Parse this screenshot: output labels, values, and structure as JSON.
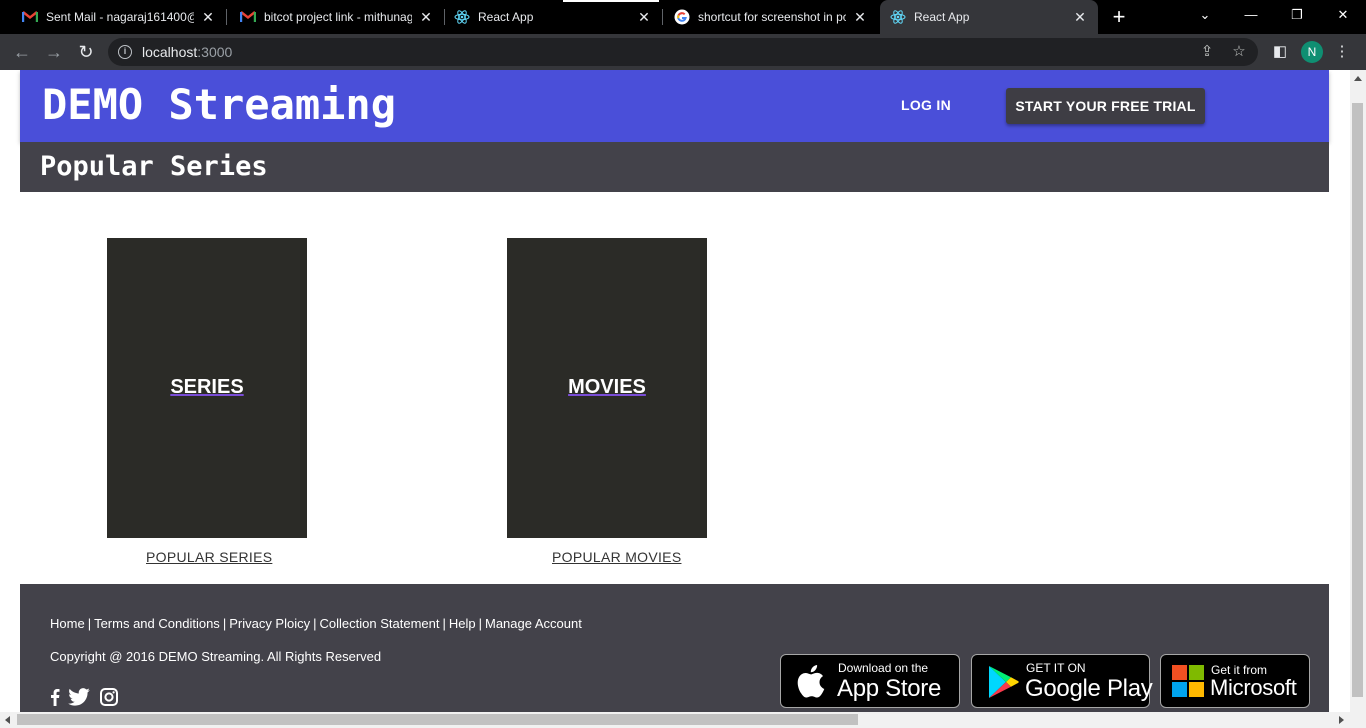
{
  "browser": {
    "tabs": [
      {
        "title": "Sent Mail - nagaraj161400@",
        "icon": "gmail-icon",
        "active": false
      },
      {
        "title": "bitcot project link - mithunag",
        "icon": "gmail-icon",
        "active": false
      },
      {
        "title": "React App",
        "icon": "react-icon",
        "active": false
      },
      {
        "title": "shortcut for screenshot in pc",
        "icon": "google-icon",
        "active": false
      },
      {
        "title": "React App",
        "icon": "react-icon",
        "active": true
      }
    ],
    "url_host": "localhost",
    "url_port": ":3000",
    "profile_initial": "N",
    "colors": {
      "chrome_dark": "#000000",
      "toolbar": "#35363a",
      "omnibox": "#202124",
      "avatar": "#0f8f72"
    }
  },
  "site": {
    "brand": "DEMO Streaming",
    "login": "LOG IN",
    "trial": "START YOUR FREE TRIAL",
    "page_heading": "Popular Series",
    "tiles": [
      {
        "label": "SERIES",
        "link": "POPULAR SERIES"
      },
      {
        "label": "MOVIES",
        "link": "POPULAR MOVIES"
      }
    ],
    "footer": {
      "links": [
        "Home",
        "Terms and Conditions",
        "Privacy Ploicy",
        "Collection Statement",
        "Help",
        "Manage Account"
      ],
      "copyright": "Copyright @ 2016 DEMO Streaming. All Rights Reserved",
      "social_icons": [
        "facebook-icon",
        "twitter-icon",
        "instagram-icon"
      ],
      "stores": {
        "apple": {
          "small": "Download on the",
          "large": "App Store"
        },
        "google": {
          "small": "GET IT ON",
          "large": "Google Play"
        },
        "microsoft": {
          "small": "Get it from",
          "large": "Microsoft"
        }
      }
    },
    "colors": {
      "header": "#4a4fd9",
      "subheader": "#43424a",
      "tile": "#2b2b27",
      "button": "#3e3d44"
    }
  }
}
